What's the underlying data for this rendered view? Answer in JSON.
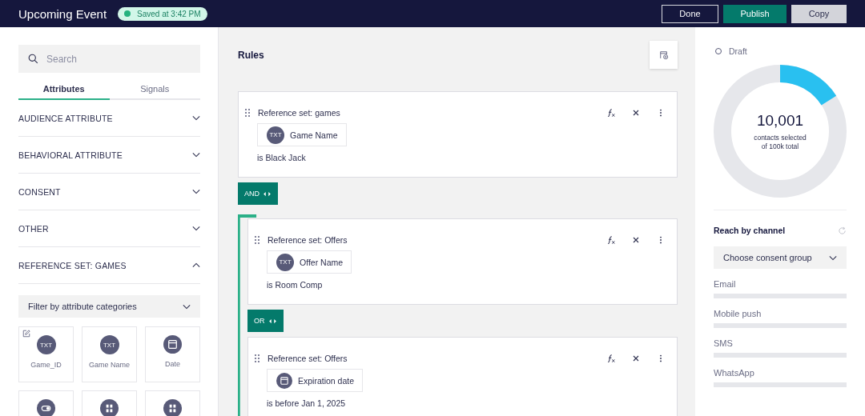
{
  "header": {
    "title": "Upcoming Event",
    "save_status": "Saved at 3:42 PM",
    "buttons": [
      {
        "label": "Done",
        "kind": "outline"
      },
      {
        "label": "Publish",
        "kind": "primary"
      },
      {
        "label": "Copy",
        "kind": "secondary"
      }
    ]
  },
  "sidebar": {
    "search": {
      "placeholder": "Search"
    },
    "tabs": [
      {
        "label": "Attributes",
        "selected": true
      },
      {
        "label": "Signals",
        "selected": false
      }
    ],
    "sections": [
      {
        "label": "AUDIENCE ATTRIBUTE",
        "expanded": false
      },
      {
        "label": "BEHAVIORAL ATTRIBUTE",
        "expanded": false
      },
      {
        "label": "CONSENT",
        "expanded": false
      },
      {
        "label": "OTHER",
        "expanded": false
      },
      {
        "label": "REFERENCE SET: GAMES",
        "expanded": true,
        "filter": "Filter by attribute categories",
        "tiles": [
          {
            "kind": "text",
            "badge": "TXT",
            "name": "Game_ID",
            "editable": true
          },
          {
            "kind": "text",
            "badge": "TXT",
            "name": "Game Name",
            "editable": false
          },
          {
            "kind": "date",
            "name": "Date",
            "editable": false
          },
          {
            "kind": "toggle",
            "editable": false
          },
          {
            "kind": "number",
            "editable": false
          },
          {
            "kind": "number",
            "editable": false
          }
        ]
      }
    ]
  },
  "rules": {
    "title": "Rules",
    "items": [
      {
        "kind": "rule",
        "title": "Reference set: games",
        "attribute": {
          "kind": "text",
          "badge": "TXT",
          "name": "Game Name"
        },
        "condition": "is Black Jack"
      },
      {
        "kind": "operator",
        "label": "AND"
      },
      {
        "kind": "group",
        "items": [
          {
            "kind": "rule",
            "title": "Reference set: Offers",
            "attribute": {
              "kind": "text",
              "badge": "TXT",
              "name": "Offer Name"
            },
            "condition": "is Room Comp"
          },
          {
            "kind": "operator",
            "label": "OR"
          },
          {
            "kind": "rule",
            "title": "Reference set: Offers",
            "attribute": {
              "kind": "date",
              "name": "Expiration date"
            },
            "condition": "is before Jan 1, 2025"
          }
        ]
      }
    ]
  },
  "summary": {
    "status": "Draft",
    "donut": {
      "level": 0.16,
      "count": "10,001",
      "caption": "contacts selected",
      "total": "of 100k total"
    },
    "reach": {
      "title": "Reach by channel",
      "dropdown": "Choose consent group",
      "channels": [
        {
          "name": "Email"
        },
        {
          "name": "Mobile push"
        },
        {
          "name": "SMS"
        },
        {
          "name": "WhatsApp"
        }
      ]
    }
  }
}
